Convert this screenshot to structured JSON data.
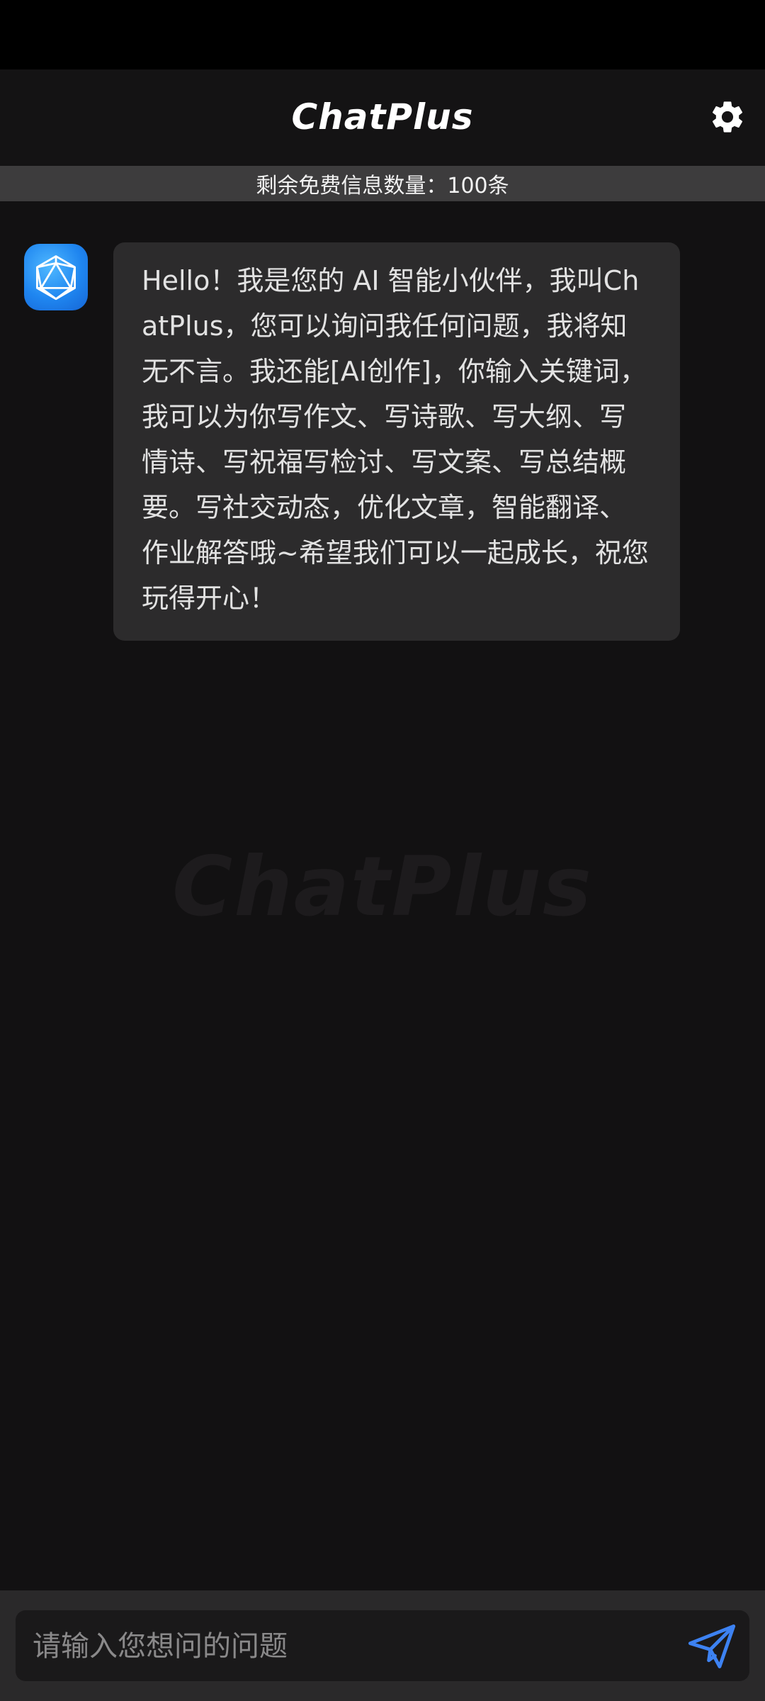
{
  "header": {
    "title": "ChatPlus",
    "settings_icon": "gear-icon"
  },
  "quota": {
    "text": "剩余免费信息数量：100条"
  },
  "chat": {
    "messages": [
      {
        "sender": "assistant",
        "avatar_icon": "icosahedron-icon",
        "text": "Hello！我是您的 AI 智能小伙伴，我叫ChatPlus，您可以询问我任何问题，我将知无不言。我还能[AI创作]，你输入关键词，我可以为你写作文、写诗歌、写大纲、写情诗、写祝福写检讨、写文案、写总结概要。写社交动态，优化文章，智能翻译、作业解答哦~希望我们可以一起成长，祝您玩得开心！"
      }
    ],
    "watermark": "ChatPlus"
  },
  "composer": {
    "placeholder": "请输入您想问的问题",
    "value": "",
    "send_icon": "paper-plane-icon"
  },
  "colors": {
    "background": "#121112",
    "bubble": "#2c2b2c",
    "accent": "#3d82f2",
    "avatar": "#1f86f0"
  }
}
